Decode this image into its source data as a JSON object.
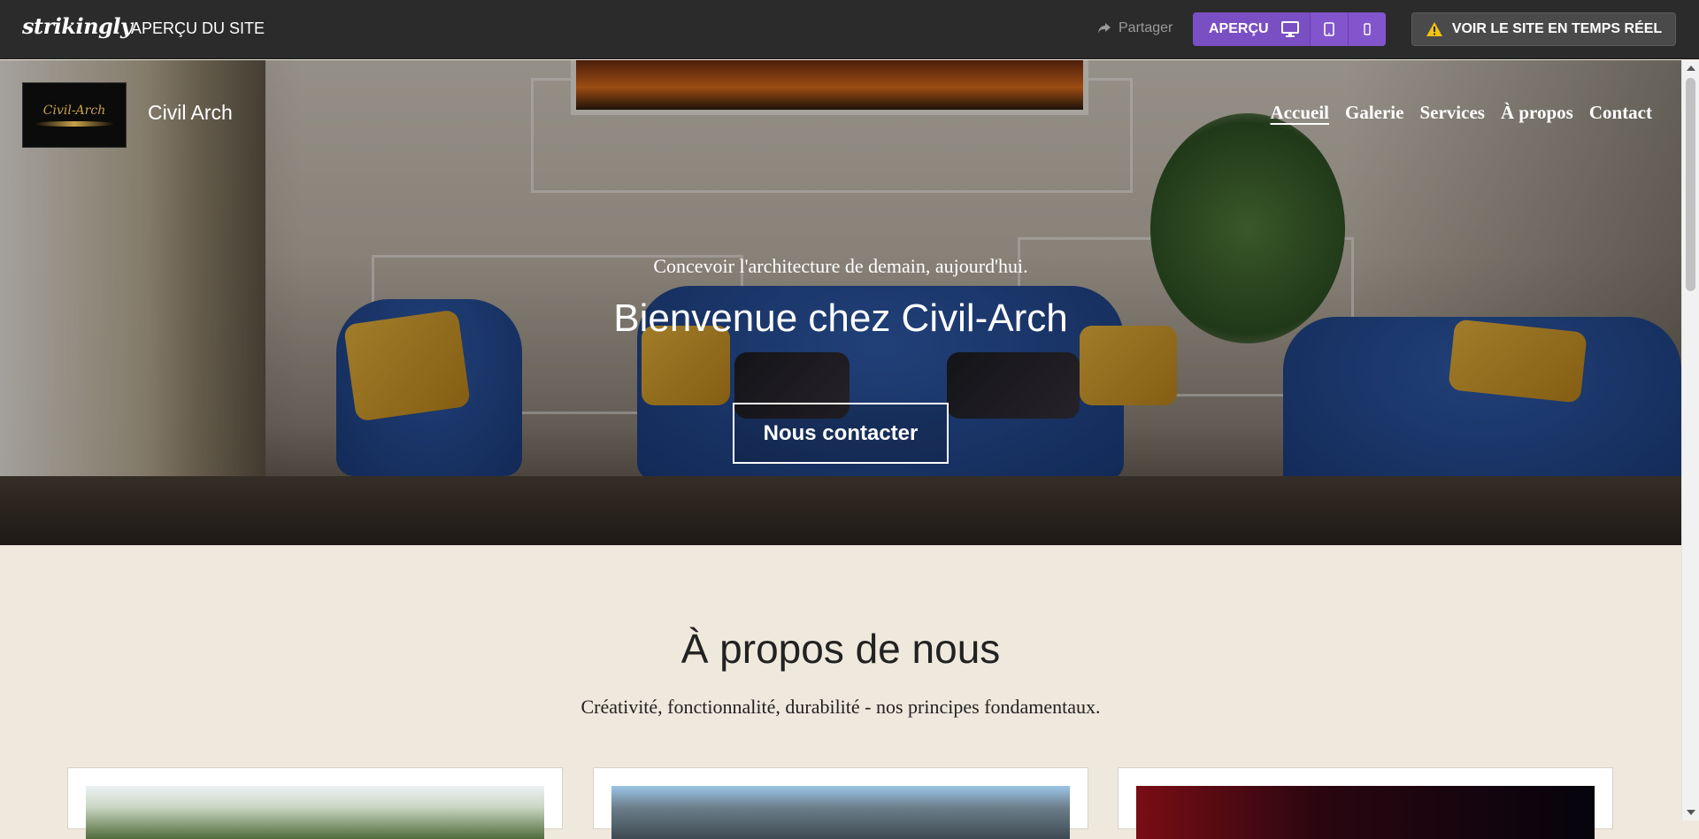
{
  "editor_bar": {
    "brand": "strikingly",
    "title": "APERÇU DU SITE",
    "share_label": "Partager",
    "preview_label": "APERÇU",
    "live_label": "VOIR LE SITE EN TEMPS RÉEL",
    "icons": [
      "share-icon",
      "desktop-icon",
      "tablet-icon",
      "mobile-icon",
      "warning-icon"
    ],
    "colors": {
      "bar": "#2b2b2b",
      "preview_accent": "#7b4fc4",
      "warning": "#f4c20d"
    }
  },
  "site": {
    "logo_text": "Civil-Arch",
    "name": "Civil Arch",
    "nav": [
      {
        "label": "Accueil",
        "active": true
      },
      {
        "label": "Galerie",
        "active": false
      },
      {
        "label": "Services",
        "active": false
      },
      {
        "label": "À propos",
        "active": false
      },
      {
        "label": "Contact",
        "active": false
      }
    ]
  },
  "hero": {
    "tagline": "Concevoir l'architecture de demain, aujourd'hui.",
    "title": "Bienvenue chez Civil-Arch",
    "cta_label": "Nous contacter"
  },
  "about": {
    "title": "À propos de nous",
    "subtitle": "Créativité, fonctionnalité, durabilité - nos principes fondamentaux."
  }
}
